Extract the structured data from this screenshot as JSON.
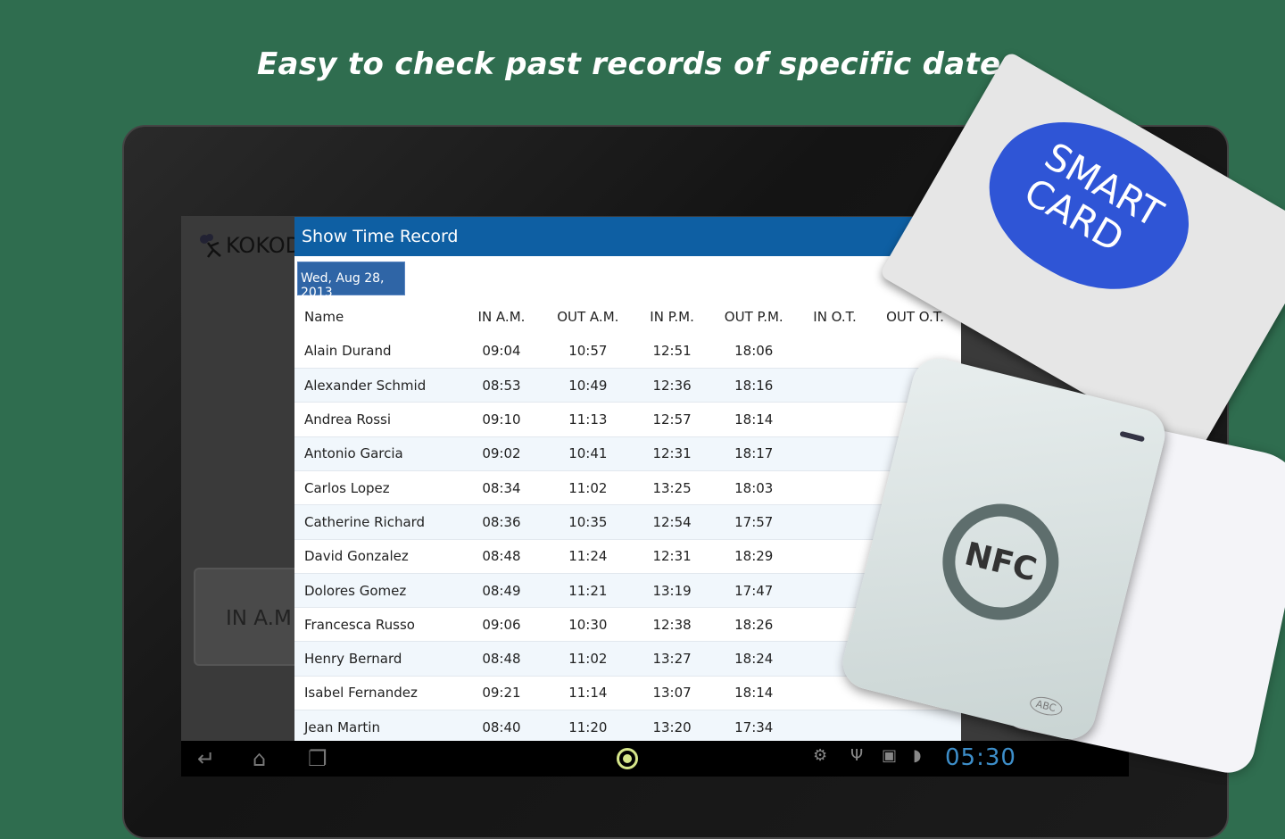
{
  "headline": "Easy to check past records of specific date.",
  "app": {
    "logo_text": "KOKOD",
    "in_am_label": "IN A.M"
  },
  "dialog": {
    "title": "Show Time Record",
    "date": "Wed, Aug 28, 2013",
    "columns": [
      "Name",
      "IN A.M.",
      "OUT A.M.",
      "IN P.M.",
      "OUT P.M.",
      "IN O.T.",
      "OUT O.T."
    ],
    "rows": [
      [
        "Alain Durand",
        "09:04",
        "10:57",
        "12:51",
        "18:06",
        "",
        ""
      ],
      [
        "Alexander Schmid",
        "08:53",
        "10:49",
        "12:36",
        "18:16",
        "",
        ""
      ],
      [
        "Andrea Rossi",
        "09:10",
        "11:13",
        "12:57",
        "18:14",
        "",
        ""
      ],
      [
        "Antonio Garcia",
        "09:02",
        "10:41",
        "12:31",
        "18:17",
        "",
        ""
      ],
      [
        "Carlos Lopez",
        "08:34",
        "11:02",
        "13:25",
        "18:03",
        "",
        ""
      ],
      [
        "Catherine Richard",
        "08:36",
        "10:35",
        "12:54",
        "17:57",
        "",
        ""
      ],
      [
        "David Gonzalez",
        "08:48",
        "11:24",
        "12:31",
        "18:29",
        "",
        ""
      ],
      [
        "Dolores Gomez",
        "08:49",
        "11:21",
        "13:19",
        "17:47",
        "",
        ""
      ],
      [
        "Francesca Russo",
        "09:06",
        "10:30",
        "12:38",
        "18:26",
        "",
        ""
      ],
      [
        "Henry Bernard",
        "08:48",
        "11:02",
        "13:27",
        "18:24",
        "",
        ""
      ],
      [
        "Isabel Fernandez",
        "09:21",
        "11:14",
        "13:07",
        "18:14",
        "",
        ""
      ],
      [
        "Jean Martin",
        "08:40",
        "11:20",
        "13:20",
        "17:34",
        "",
        ""
      ]
    ]
  },
  "navbar": {
    "clock": "05:30",
    "icons": [
      "back-icon",
      "home-icon",
      "recent-apps-icon",
      "camera-icon",
      "android-debug-icon",
      "usb-icon",
      "play-store-icon",
      "nfc-signal-icon"
    ]
  },
  "decor": {
    "card_text": "SMART CARD",
    "reader_text": "NFC",
    "reader_badge": "ABC"
  },
  "colors": {
    "background": "#2f6d4f",
    "title_bar": "#0e5fa3",
    "date_button": "#2f65a6",
    "clock": "#3d8ec9",
    "cloud": "#2f55d6"
  }
}
